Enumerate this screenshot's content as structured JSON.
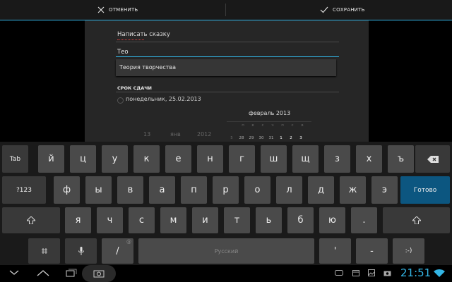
{
  "actionbar": {
    "cancel_label": "ОТМЕНИТЬ",
    "save_label": "СОХРАНИТЬ"
  },
  "form": {
    "title": "Написать сказку",
    "search_value": "Тео",
    "suggestion": "Теория творчества",
    "section_label": "СРОК СДАЧИ",
    "due_date": "понедельник, 25.02.2013"
  },
  "picker": {
    "day": "13",
    "month": "янв",
    "year": "2012"
  },
  "calendar": {
    "month": "февраль 2013",
    "weekdays": [
      "п",
      "в",
      "с",
      "ч",
      "п",
      "с",
      "в"
    ],
    "days": [
      "28",
      "29",
      "30",
      "31",
      "1",
      "2",
      "3"
    ]
  },
  "keyboard": {
    "row1": [
      "Tab",
      "й",
      "ц",
      "у",
      "к",
      "е",
      "н",
      "г",
      "ш",
      "щ",
      "з",
      "х",
      "ъ"
    ],
    "row2": [
      "?123",
      "ф",
      "ы",
      "в",
      "а",
      "п",
      "р",
      "о",
      "л",
      "д",
      "ж",
      "э",
      "Готово"
    ],
    "row3": [
      "я",
      "ч",
      "с",
      "м",
      "и",
      "т",
      "ь",
      "б",
      "ю",
      "."
    ],
    "row4_slash": "/",
    "row4_slash_sup": "@",
    "space_label": "Русский",
    "row4_apos": "'",
    "row4_dash": "-",
    "row4_smiley": ":-)"
  },
  "status": {
    "time": "21:51"
  },
  "colors": {
    "accent": "#33b5e5",
    "key": "#4a4a4a",
    "go_key": "#0c5680"
  }
}
